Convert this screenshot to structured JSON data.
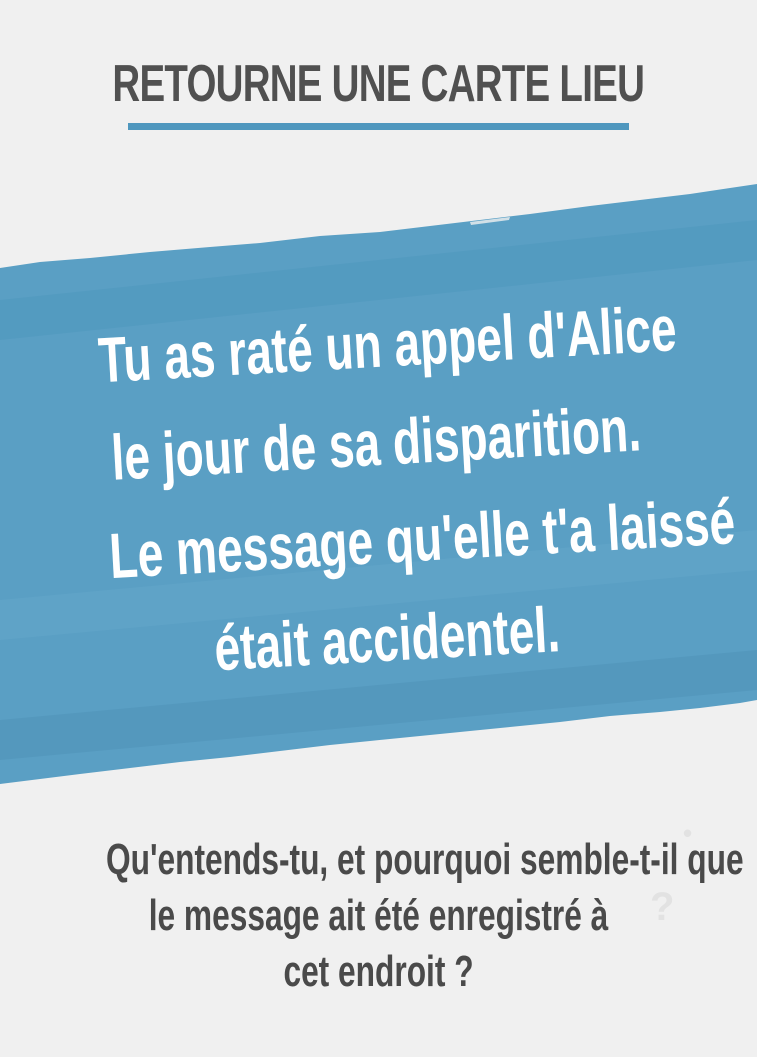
{
  "card": {
    "title": "RETOURNE UNE CARTE LIEU",
    "main_lines": [
      "Tu as raté un appel d'Alice",
      "le jour de sa disparition.",
      "Le message qu'elle t'a laissé",
      "était accidentel."
    ],
    "question_lines": [
      "Qu'entends-tu, et pourquoi semble-t-il que",
      "le message ait été enregistré à",
      "cet endroit ?"
    ]
  },
  "colors": {
    "accent_blue": "#4f97be",
    "title_gray": "#505050",
    "banner_text": "#ffffff",
    "background": "#f0f0f0"
  }
}
